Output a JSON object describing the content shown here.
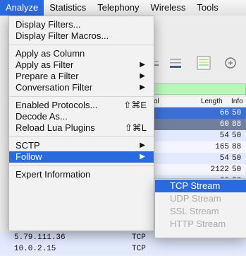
{
  "menubar": {
    "items": [
      "Analyze",
      "Statistics",
      "Telephony",
      "Wireless",
      "Tools"
    ]
  },
  "analyze_menu": {
    "display_filters": "Display Filters...",
    "display_filter_macros": "Display Filter Macros...",
    "apply_as_column": "Apply as Column",
    "apply_as_filter": "Apply as Filter",
    "prepare_a_filter": "Prepare a Filter",
    "conversation_filter": "Conversation Filter",
    "enabled_protocols": "Enabled Protocols...",
    "enabled_protocols_shortcut": "⇧⌘E",
    "decode_as": "Decode As...",
    "reload_lua_plugins": "Reload Lua Plugins",
    "reload_lua_plugins_shortcut": "⇧⌘L",
    "sctp": "SCTP",
    "follow": "Follow",
    "expert_information": "Expert Information",
    "arrow": "▶"
  },
  "follow_submenu": {
    "tcp_stream": "TCP Stream",
    "udp_stream": "UDP Stream",
    "ssl_stream": "SSL Stream",
    "http_stream": "HTTP Stream"
  },
  "packet_list": {
    "col_protocol": "ol",
    "col_length": "Length",
    "col_info": "Info",
    "rows": [
      {
        "length": "66",
        "info": "50"
      },
      {
        "length": "60",
        "info": "88"
      },
      {
        "length": "54",
        "info": "50"
      },
      {
        "length": "165",
        "info": "88"
      },
      {
        "length": "54",
        "info": "50"
      },
      {
        "length": "2122",
        "info": "50"
      },
      {
        "length": "60",
        "info": "88"
      }
    ],
    "bottom_rows": [
      {
        "source": "5.79.111.36",
        "protocol": "TCP"
      },
      {
        "source": "10.0.2.15",
        "protocol": "TCP"
      }
    ]
  }
}
